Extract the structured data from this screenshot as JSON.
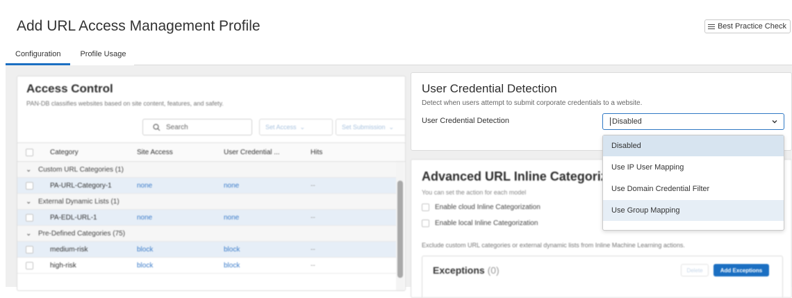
{
  "page": {
    "title": "Add URL Access Management Profile",
    "best_practice_label": "Best Practice Check"
  },
  "tabs": [
    {
      "label": "Configuration",
      "active": true
    },
    {
      "label": "Profile Usage",
      "active": false
    }
  ],
  "access_control": {
    "title": "Access Control",
    "subtitle": "PAN-DB classifies websites based on site content, features, and safety.",
    "search_placeholder": "Search",
    "set_access_label": "Set Access",
    "set_submission_label": "Set Submission",
    "columns": [
      "Category",
      "Site Access",
      "User Credential ...",
      "Hits"
    ],
    "rows": [
      {
        "type": "group",
        "label": "Custom URL Categories (1)"
      },
      {
        "type": "item",
        "category": "PA-URL-Category-1",
        "site_access": "none",
        "user_credential": "none",
        "hits": "--"
      },
      {
        "type": "group",
        "label": "External Dynamic Lists (1)"
      },
      {
        "type": "item",
        "category": "PA-EDL-URL-1",
        "site_access": "none",
        "user_credential": "none",
        "hits": "--"
      },
      {
        "type": "group",
        "label": "Pre-Defined Categories (75)"
      },
      {
        "type": "item",
        "category": "medium-risk",
        "site_access": "block",
        "user_credential": "block",
        "hits": "--"
      },
      {
        "type": "item",
        "category": "high-risk",
        "site_access": "block",
        "user_credential": "block",
        "hits": "--"
      }
    ]
  },
  "user_credential_detection": {
    "title": "User Credential Detection",
    "description": "Detect when users attempt to submit corporate credentials to a website.",
    "field_label": "User Credential Detection",
    "selected_value": "Disabled",
    "options": [
      "Disabled",
      "Use IP User Mapping",
      "Use Domain Credential Filter",
      "Use Group Mapping"
    ]
  },
  "advanced_inline": {
    "title": "Advanced URL Inline Categorizat",
    "subtitle": "You can set the action for each model",
    "options": [
      "Enable cloud Inline Categorization",
      "Enable local Inline Categorization"
    ],
    "note": "Exclude custom URL categories or external dynamic lists from Inline Machine Learning actions.",
    "exceptions_title": "Exceptions",
    "exceptions_count": "(0)",
    "delete_label": "Delete",
    "add_label": "Add Exceptions"
  },
  "colors": {
    "accent": "#1b6fc2",
    "link": "#3b7cc9",
    "dropdown_selected": "#d7e4f0"
  }
}
